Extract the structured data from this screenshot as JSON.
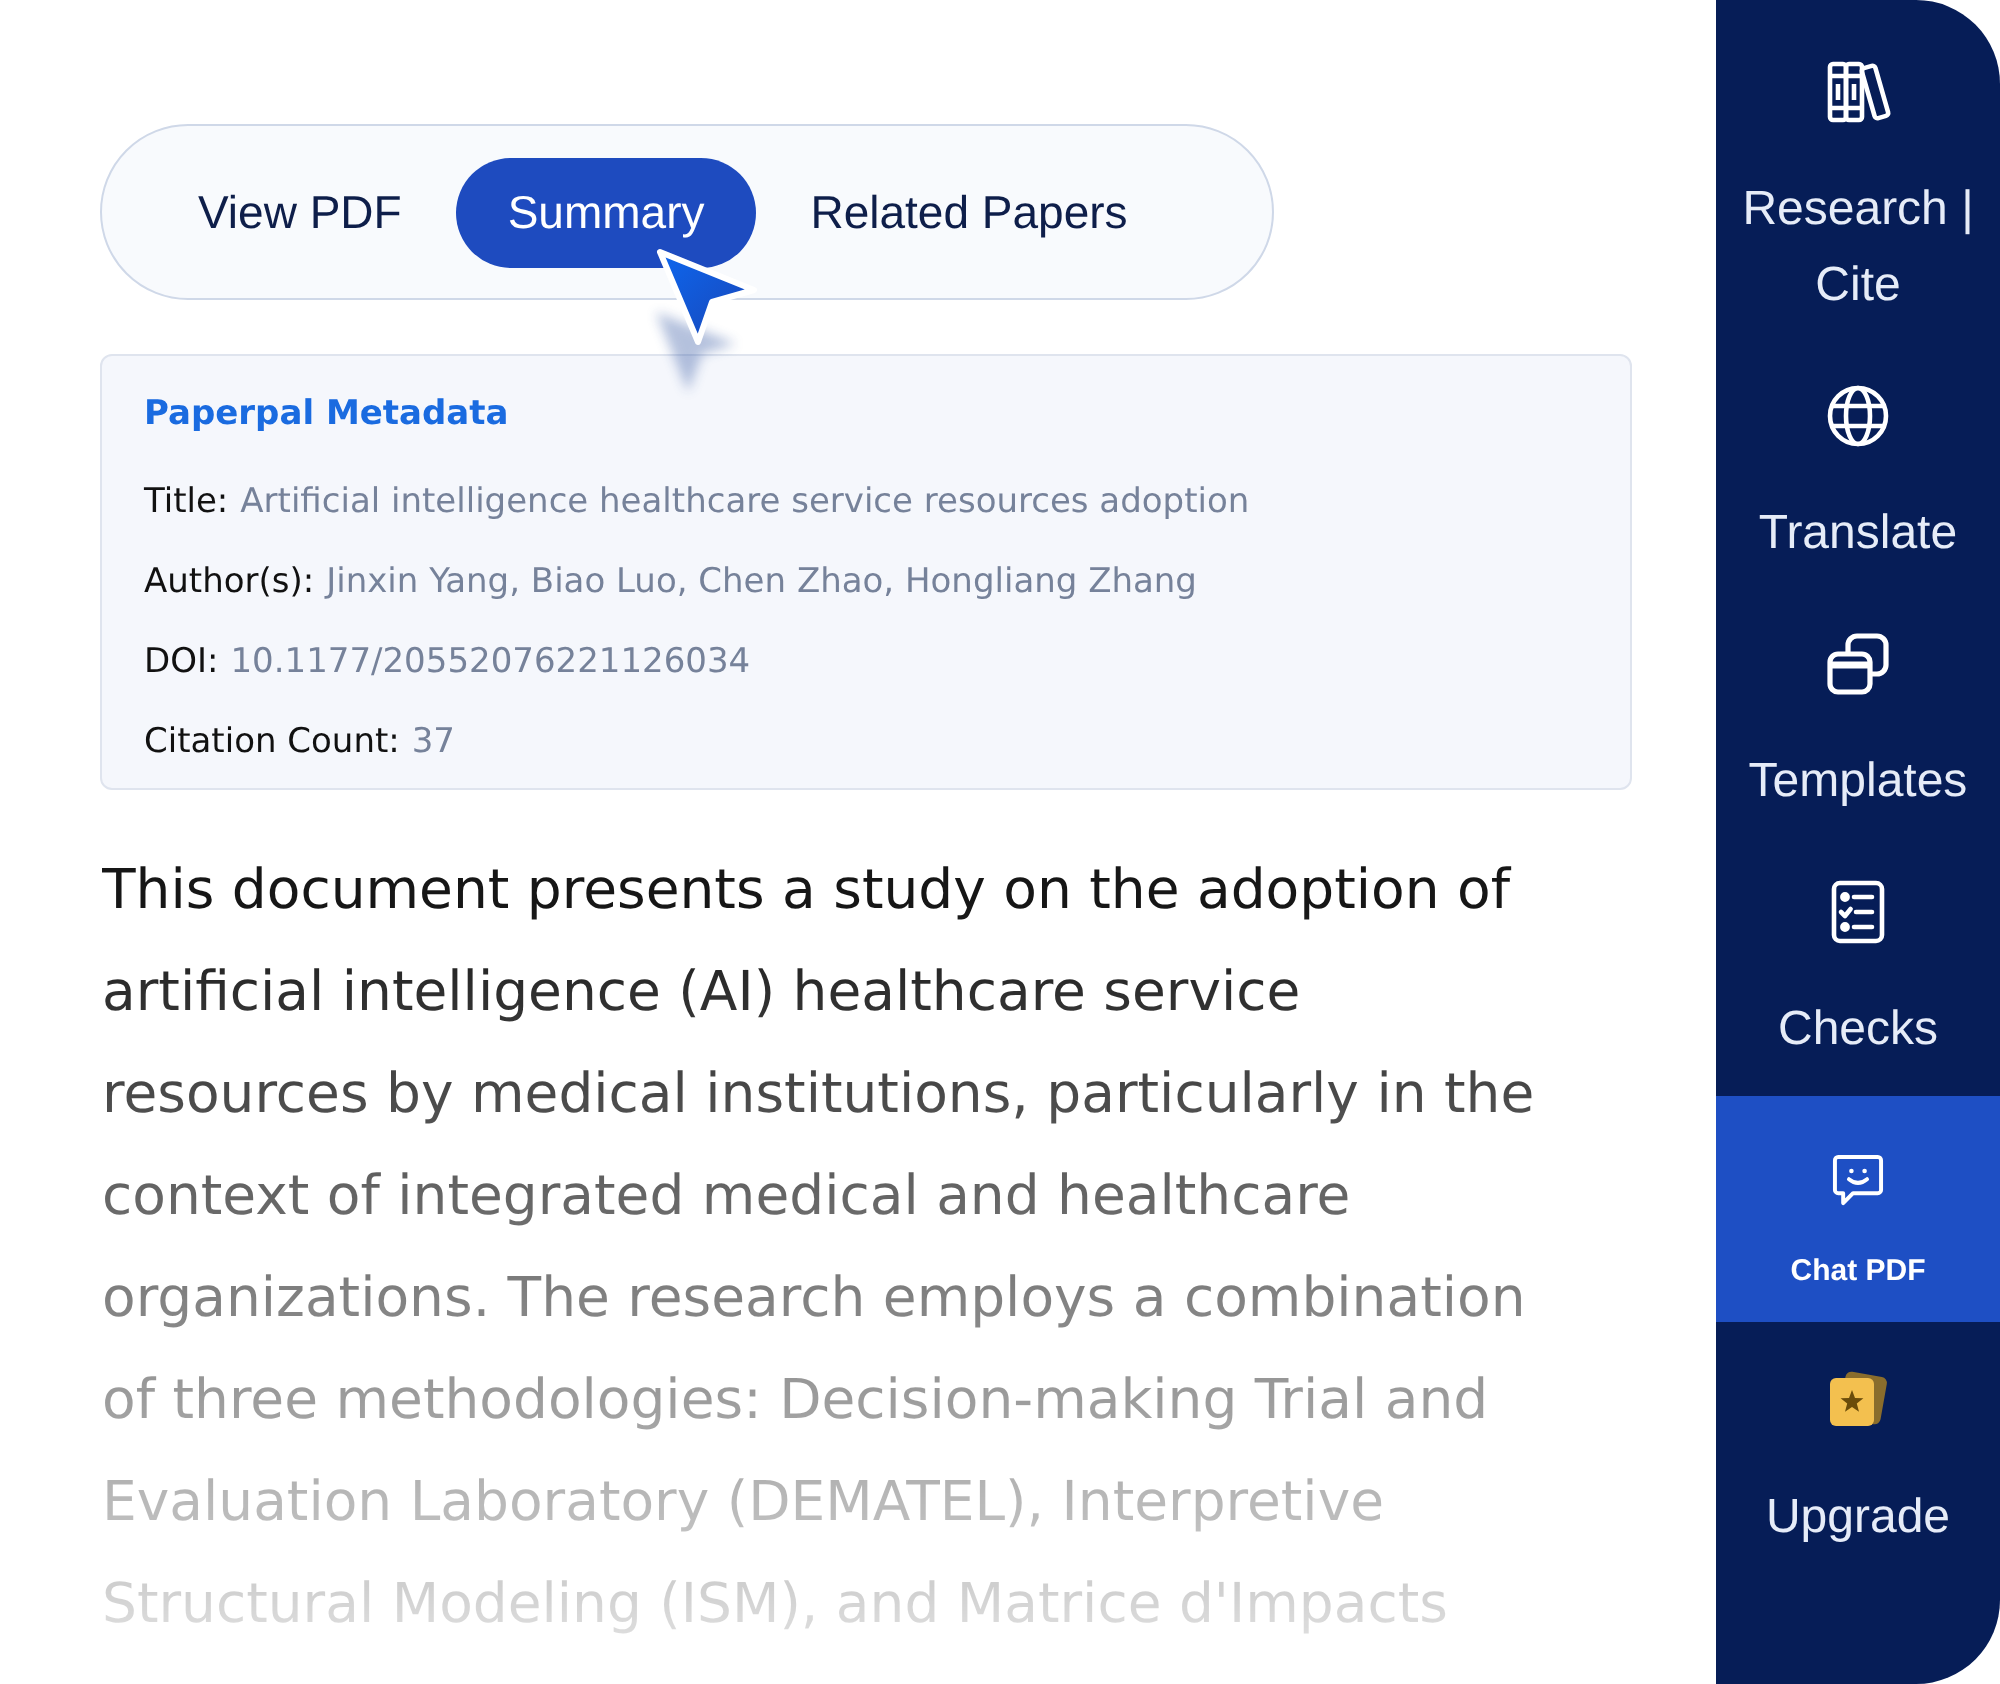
{
  "tabs": [
    {
      "label": "View PDF",
      "selected": false
    },
    {
      "label": "Summary",
      "selected": true
    },
    {
      "label": "Related Papers",
      "selected": false
    }
  ],
  "metadata": {
    "heading": "Paperpal Metadata",
    "fields": [
      {
        "label": "Title:",
        "value": "Artificial intelligence healthcare service resources adoption"
      },
      {
        "label": "Author(s):",
        "value": "Jinxin Yang, Biao Luo, Chen Zhao, Hongliang Zhang"
      },
      {
        "label": "DOI:",
        "value": "10.1177/20552076221126034"
      },
      {
        "label": "Citation Count:",
        "value": "37"
      }
    ]
  },
  "summary": {
    "text": "This document presents a study on the adoption of artificial intelligence (AI) healthcare service resources by medical institutions, particularly in the context of integrated medical and healthcare organizations. The research employs a combination of three methodologies: Decision-making Trial and Evaluation Laboratory (DEMATEL), Interpretive Structural Modeling (ISM), and Matrice d'Impacts"
  },
  "sidebar": {
    "items": [
      {
        "label": "Research | Cite",
        "selected": false
      },
      {
        "label": "Translate",
        "selected": false
      },
      {
        "label": "Templates",
        "selected": false
      },
      {
        "label": "Checks",
        "selected": false
      },
      {
        "label": "Chat PDF",
        "selected": true
      },
      {
        "label": "Upgrade",
        "selected": false
      }
    ]
  }
}
